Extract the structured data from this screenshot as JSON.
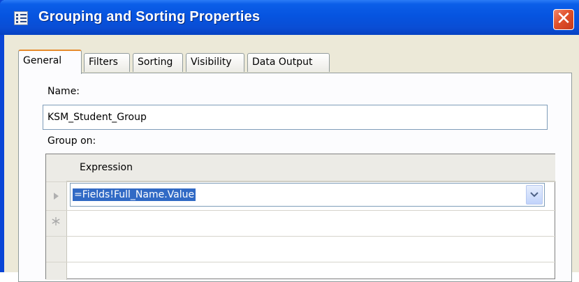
{
  "window": {
    "title": "Grouping and Sorting Properties",
    "close_glyph": "✕"
  },
  "tabs": [
    {
      "label": "General",
      "active": true
    },
    {
      "label": "Filters",
      "active": false
    },
    {
      "label": "Sorting",
      "active": false
    },
    {
      "label": "Visibility",
      "active": false
    },
    {
      "label": "Data Output",
      "active": false
    }
  ],
  "general": {
    "name_label": "Name:",
    "name_value": "KSM_Student_Group",
    "group_on_label": "Group on:"
  },
  "grid": {
    "column_header": "Expression",
    "rows": [
      {
        "marker": "current-row-arrow",
        "expression": "=Fields!Full_Name.Value"
      },
      {
        "marker": "new-row-asterisk",
        "expression": ""
      }
    ],
    "dropdown_icon": "chevron-down-icon"
  },
  "colors": {
    "titlebar": "#0654e0",
    "close_button": "#e0512b",
    "dialog_bg": "#ece9d8",
    "active_tab_accent": "#e68b2c",
    "selection": "#316ac5"
  }
}
